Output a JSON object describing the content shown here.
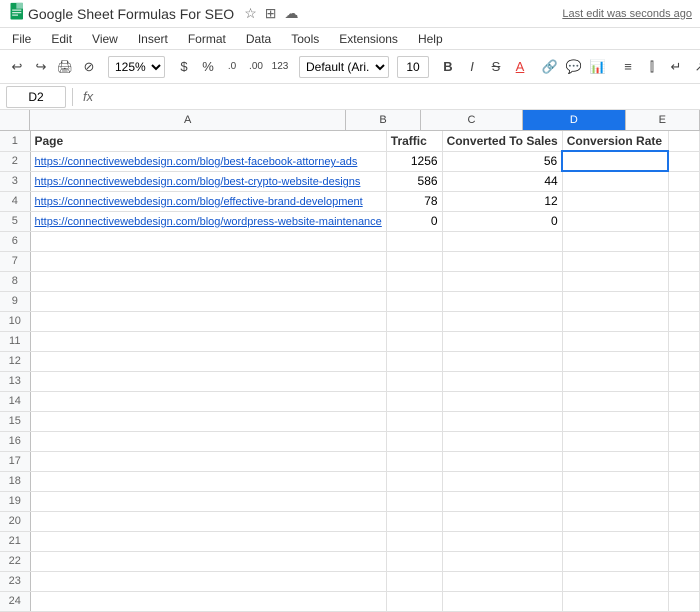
{
  "title": {
    "app_name": "Google Sheet Formulas For SEO",
    "last_edit": "Last edit was seconds ago",
    "icons": [
      "star",
      "rename",
      "cloud"
    ]
  },
  "menu": {
    "items": [
      "File",
      "Edit",
      "View",
      "Insert",
      "Format",
      "Data",
      "Tools",
      "Extensions",
      "Help"
    ]
  },
  "toolbar": {
    "zoom": "125%",
    "currency": "$",
    "percent": "%",
    "decimal_decrease": ".0",
    "decimal_increase": ".00",
    "format_123": "123",
    "font": "Default (Ari...",
    "font_size": "10"
  },
  "formula_bar": {
    "cell_ref": "D2",
    "fx_label": "fx"
  },
  "columns": {
    "headers": [
      "",
      "A",
      "B",
      "C",
      "D",
      "E"
    ],
    "widths": [
      30,
      340,
      80,
      110,
      110,
      80
    ]
  },
  "rows": [
    {
      "num": 1,
      "a": "Page",
      "b": "Traffic",
      "c": "Converted To Sales",
      "d": "Conversion Rate",
      "e": "",
      "is_header": true
    },
    {
      "num": 2,
      "a": "https://connectivewebdesign.com/blog/best-facebook-attorney-ads",
      "b": "1256",
      "c": "56",
      "d": "",
      "e": "",
      "is_link": true,
      "selected_d": true
    },
    {
      "num": 3,
      "a": "https://connectivewebdesign.com/blog/best-crypto-website-designs",
      "b": "586",
      "c": "44",
      "d": "",
      "e": "",
      "is_link": true
    },
    {
      "num": 4,
      "a": "https://connectivewebdesign.com/blog/effective-brand-development",
      "b": "78",
      "c": "12",
      "d": "",
      "e": "",
      "is_link": true
    },
    {
      "num": 5,
      "a": "https://connectivewebdesign.com/blog/wordpress-website-maintenance",
      "b": "0",
      "c": "0",
      "d": "",
      "e": "",
      "is_link": true
    }
  ],
  "empty_rows": [
    6,
    7,
    8,
    9,
    10,
    11,
    12,
    13,
    14,
    15,
    16,
    17,
    18,
    19,
    20,
    21,
    22,
    23,
    24
  ]
}
